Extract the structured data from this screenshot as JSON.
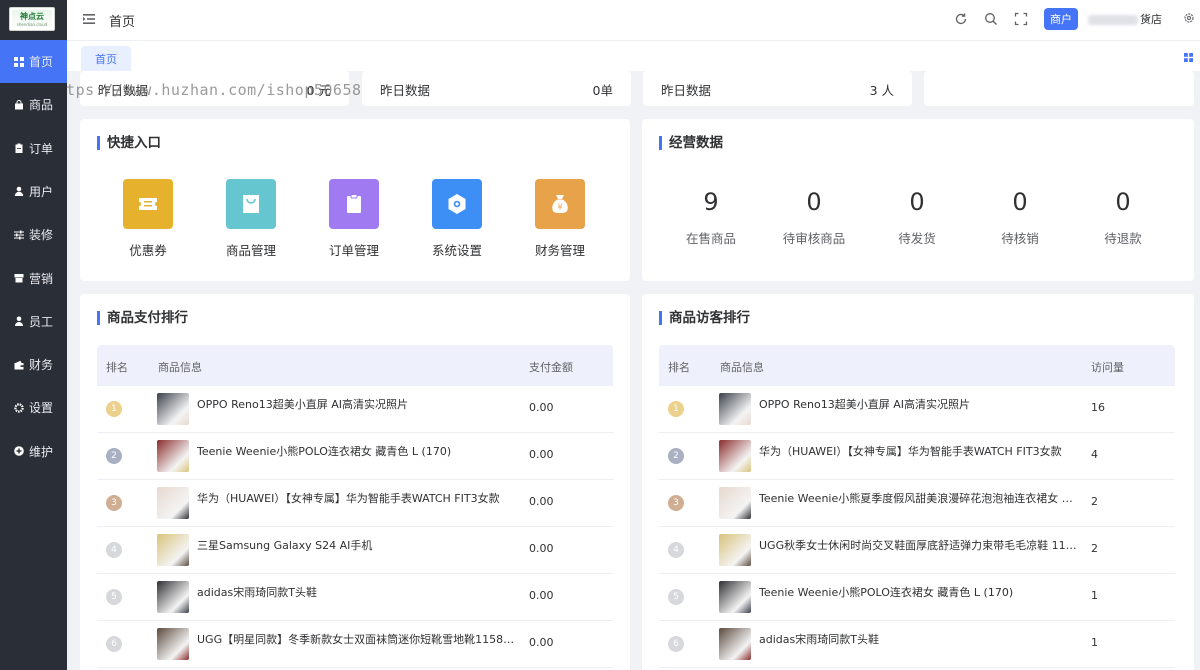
{
  "brand": {
    "logo_text": "神点云",
    "logo_sub": "shendian.cloud"
  },
  "sidebar": {
    "items": [
      {
        "label": "首页",
        "icon": "grid-icon"
      },
      {
        "label": "商品",
        "icon": "bag-icon"
      },
      {
        "label": "订单",
        "icon": "clipboard-icon"
      },
      {
        "label": "用户",
        "icon": "user-icon"
      },
      {
        "label": "装修",
        "icon": "sliders-icon"
      },
      {
        "label": "营销",
        "icon": "shop-icon"
      },
      {
        "label": "员工",
        "icon": "person-icon"
      },
      {
        "label": "财务",
        "icon": "wallet-icon"
      },
      {
        "label": "设置",
        "icon": "gear-icon"
      },
      {
        "label": "维护",
        "icon": "plus-circle-icon"
      }
    ],
    "active_index": 0
  },
  "header": {
    "breadcrumb": "首页",
    "merchant_button": "商户",
    "shop_suffix": "货店"
  },
  "tabs": [
    {
      "label": "首页"
    }
  ],
  "watermark": "https://www.huzhan.com/ishop50658",
  "stats": [
    {
      "label": "昨日数据",
      "value": "0 元"
    },
    {
      "label": "昨日数据",
      "value": "0单"
    },
    {
      "label": "昨日数据",
      "value": "3 人"
    },
    {
      "label": "",
      "value": ""
    }
  ],
  "quick_entry": {
    "title": "快捷入口",
    "items": [
      {
        "label": "优惠券",
        "icon": "coupon-icon",
        "color": "#e6b22e"
      },
      {
        "label": "商品管理",
        "icon": "shopping-bag-icon",
        "color": "#66c6d0"
      },
      {
        "label": "订单管理",
        "icon": "clipboard-icon",
        "color": "#9f7af0"
      },
      {
        "label": "系统设置",
        "icon": "hexagon-settings-icon",
        "color": "#3d8ff6"
      },
      {
        "label": "财务管理",
        "icon": "money-bag-icon",
        "color": "#e8a24a"
      }
    ]
  },
  "business": {
    "title": "经营数据",
    "items": [
      {
        "value": "9",
        "label": "在售商品"
      },
      {
        "value": "0",
        "label": "待审核商品"
      },
      {
        "value": "0",
        "label": "待发货"
      },
      {
        "value": "0",
        "label": "待核销"
      },
      {
        "value": "0",
        "label": "待退款"
      }
    ]
  },
  "pay_rank": {
    "title": "商品支付排行",
    "columns": [
      "排名",
      "商品信息",
      "支付金额"
    ],
    "rows": [
      {
        "rank": "1",
        "name": "OPPO Reno13超美小直屏 AI高清实况照片",
        "value": "0.00"
      },
      {
        "rank": "2",
        "name": "Teenie Weenie小熊POLO连衣裙女 藏青色 L (170)",
        "value": "0.00"
      },
      {
        "rank": "3",
        "name": "华为（HUAWEI）【女神专属】华为智能手表WATCH FIT3女款",
        "value": "0.00"
      },
      {
        "rank": "4",
        "name": "三星Samsung Galaxy S24 AI手机",
        "value": "0.00"
      },
      {
        "rank": "5",
        "name": "adidas宋雨琦同款T头鞋",
        "value": "0.00"
      },
      {
        "rank": "6",
        "name": "UGG【明星同款】冬季新款女士双面袜筒迷你短靴雪地靴1158275…",
        "value": "0.00"
      }
    ]
  },
  "visit_rank": {
    "title": "商品访客排行",
    "columns": [
      "排名",
      "商品信息",
      "访问量"
    ],
    "rows": [
      {
        "rank": "1",
        "name": "OPPO Reno13超美小直屏 AI高清实况照片",
        "value": "16"
      },
      {
        "rank": "2",
        "name": "华为（HUAWEI）【女神专属】华为智能手表WATCH FIT3女款",
        "value": "4"
      },
      {
        "rank": "3",
        "name": "Teenie Weenie小熊夏季度假风甜美浪漫碎花泡泡袖连衣裙女 撞色 …",
        "value": "2"
      },
      {
        "rank": "4",
        "name": "UGG秋季女士休闲时尚交叉鞋面厚底舒适弹力束带毛毛凉鞋 1121…",
        "value": "2"
      },
      {
        "rank": "5",
        "name": "Teenie Weenie小熊POLO连衣裙女 藏青色 L (170)",
        "value": "1"
      },
      {
        "rank": "6",
        "name": "adidas宋雨琦同款T头鞋",
        "value": "1"
      }
    ]
  },
  "colors": {
    "accent": "#4674f6",
    "sidebar_bg": "#2a2e37",
    "rank_1": "#ecd18c",
    "rank_2": "#a9b0c2",
    "rank_3": "#cfae93",
    "rank_other": "#d6d8dc"
  }
}
